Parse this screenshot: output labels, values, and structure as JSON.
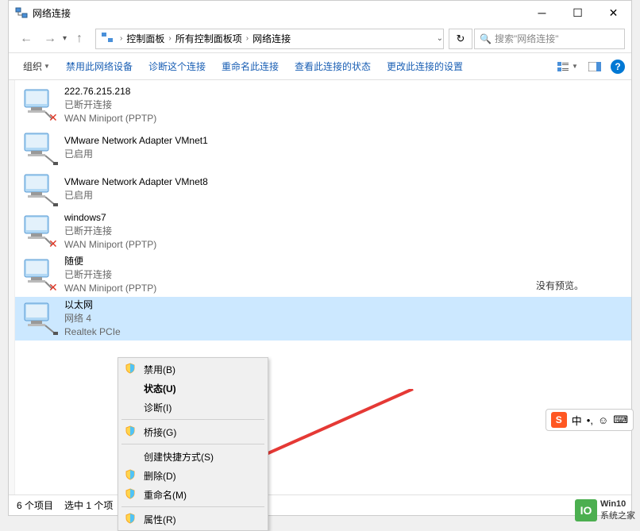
{
  "titlebar": {
    "title": "网络连接"
  },
  "navbar": {
    "breadcrumbs": [
      "控制面板",
      "所有控制面板项",
      "网络连接"
    ],
    "search_placeholder": "搜索\"网络连接\""
  },
  "toolbar": {
    "organize": "组织",
    "items": [
      "禁用此网络设备",
      "诊断这个连接",
      "重命名此连接",
      "查看此连接的状态",
      "更改此连接的设置"
    ]
  },
  "connections": [
    {
      "name": "222.76.215.218",
      "status": "已断开连接",
      "device": "WAN Miniport (PPTP)",
      "selected": false
    },
    {
      "name": "VMware Network Adapter VMnet1",
      "status": "已启用",
      "device": "",
      "selected": false
    },
    {
      "name": "VMware Network Adapter VMnet8",
      "status": "已启用",
      "device": "",
      "selected": false
    },
    {
      "name": "windows7",
      "status": "已断开连接",
      "device": "WAN Miniport (PPTP)",
      "selected": false
    },
    {
      "name": "随便",
      "status": "已断开连接",
      "device": "WAN Miniport (PPTP)",
      "selected": false
    },
    {
      "name": "以太网",
      "status": "网络 4",
      "device": "Realtek PCIe",
      "selected": true
    }
  ],
  "preview": {
    "text": "没有预览。"
  },
  "context_menu": {
    "items": [
      {
        "label": "禁用(B)",
        "shield": true,
        "bold": false
      },
      {
        "label": "状态(U)",
        "shield": false,
        "bold": true
      },
      {
        "label": "诊断(I)",
        "shield": false,
        "bold": false
      },
      {
        "sep": true
      },
      {
        "label": "桥接(G)",
        "shield": true,
        "bold": false
      },
      {
        "sep": true
      },
      {
        "label": "创建快捷方式(S)",
        "shield": false,
        "bold": false
      },
      {
        "label": "删除(D)",
        "shield": true,
        "bold": false
      },
      {
        "label": "重命名(M)",
        "shield": true,
        "bold": false
      },
      {
        "sep": true
      },
      {
        "label": "属性(R)",
        "shield": true,
        "bold": false
      }
    ]
  },
  "statusbar": {
    "count": "6 个项目",
    "selected": "选中 1 个项"
  },
  "ime": {
    "lang": "中",
    "dot": "•,"
  },
  "watermark": {
    "line1": "Win10",
    "line2": "系统之家"
  }
}
